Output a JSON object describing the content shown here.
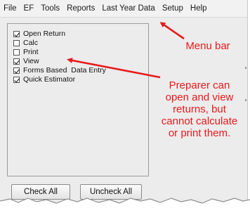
{
  "menubar": {
    "items": [
      "File",
      "EF",
      "Tools",
      "Reports",
      "Last Year Data",
      "Setup",
      "Help"
    ]
  },
  "panel": {
    "options": [
      {
        "label": "Open Return",
        "checked": true
      },
      {
        "label": "Calc",
        "checked": false
      },
      {
        "label": "Print",
        "checked": false
      },
      {
        "label": "View",
        "checked": true
      },
      {
        "label": "Forms Based  Data Entry",
        "checked": true
      },
      {
        "label": "Quick Estimator",
        "checked": true
      }
    ]
  },
  "buttons": {
    "check_all": "Check All",
    "uncheck_all": "Uncheck All"
  },
  "annotations": {
    "menu_bar": "Menu bar",
    "preparer": "Preparer can open and view returns, but cannot calculate or print them."
  },
  "colors": {
    "annotation": "#e8191b"
  }
}
